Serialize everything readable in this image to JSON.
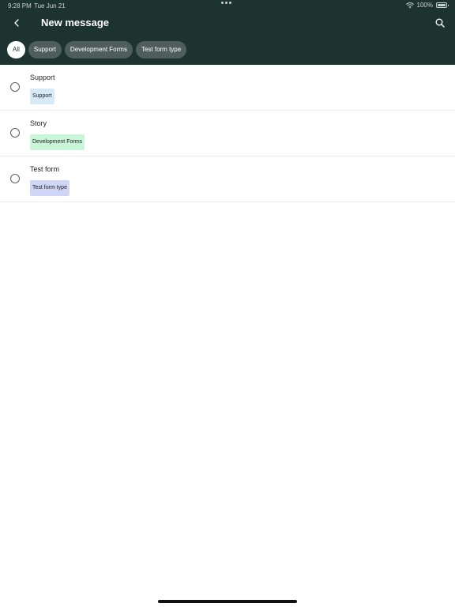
{
  "status_bar": {
    "time": "9:28 PM",
    "date": "Tue Jun 21",
    "battery": "100%"
  },
  "header": {
    "title": "New message",
    "back_icon": "chevron-left-icon",
    "search_icon": "search-icon"
  },
  "filters": [
    {
      "label": "All",
      "active": true
    },
    {
      "label": "Support",
      "active": false
    },
    {
      "label": "Development Forms",
      "active": false
    },
    {
      "label": "Test form type",
      "active": false
    }
  ],
  "forms": [
    {
      "title": "Support",
      "tag": "Support",
      "tag_color": "#d6eaf7"
    },
    {
      "title": "Story",
      "tag": "Development Forms",
      "tag_color": "#c9f5d8"
    },
    {
      "title": "Test form",
      "tag": "Test form type",
      "tag_color": "#cfd5f5"
    }
  ],
  "colors": {
    "header_bg": "#1d3330",
    "chip_bg": "#4f5e5c"
  }
}
